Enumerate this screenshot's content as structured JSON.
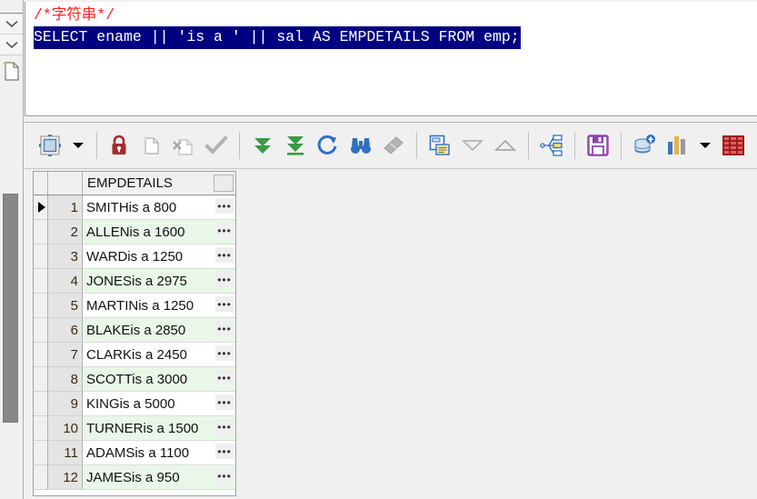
{
  "editor": {
    "comment": "/*字符串*/",
    "sql": "SELECT ename || 'is a ' || sal AS EMPDETAILS FROM emp;"
  },
  "toolbar": {
    "items": [
      {
        "name": "fit-grid-icon",
        "label": "Fit grid columns"
      },
      {
        "name": "fit-grid-dropdown-icon",
        "label": "Fit options"
      },
      {
        "name": "lock-icon",
        "label": "Lock record"
      },
      {
        "name": "new-record-icon",
        "label": "Insert record"
      },
      {
        "name": "delete-record-icon",
        "label": "Delete record"
      },
      {
        "name": "commit-check-icon",
        "label": "Post changes"
      },
      {
        "name": "fetch-next-icon",
        "label": "Fetch next page"
      },
      {
        "name": "fetch-all-icon",
        "label": "Fetch all rows"
      },
      {
        "name": "refresh-icon",
        "label": "Refresh"
      },
      {
        "name": "find-binoculars-icon",
        "label": "Find"
      },
      {
        "name": "eraser-icon",
        "label": "Clear filter"
      },
      {
        "name": "single-record-view-icon",
        "label": "Single record view"
      },
      {
        "name": "move-down-icon",
        "label": "Move down"
      },
      {
        "name": "move-up-icon",
        "label": "Move up"
      },
      {
        "name": "hierarchy-icon",
        "label": "Structure view"
      },
      {
        "name": "save-floppy-icon",
        "label": "Export data"
      },
      {
        "name": "database-upload-icon",
        "label": "Send to database"
      },
      {
        "name": "bar-chart-icon",
        "label": "Chart"
      },
      {
        "name": "bar-chart-dropdown-icon",
        "label": "Chart options"
      },
      {
        "name": "red-grid-icon",
        "label": "Grid view"
      }
    ]
  },
  "left_rail": {
    "buttons": [
      {
        "name": "rail-top-button",
        "label": ""
      },
      {
        "name": "rail-collapse-button-1",
        "label": "chevron-down"
      },
      {
        "name": "rail-collapse-button-2",
        "label": "chevron-down"
      },
      {
        "name": "rail-new-document-button",
        "label": "new-document"
      }
    ]
  },
  "grid": {
    "columns": [
      "EMPDETAILS"
    ],
    "cell_button_label": "•••",
    "rows": [
      {
        "num": "1",
        "EMPDETAILS": "SMITHis a 800",
        "current": true
      },
      {
        "num": "2",
        "EMPDETAILS": "ALLENis a 1600",
        "current": false
      },
      {
        "num": "3",
        "EMPDETAILS": "WARDis a 1250",
        "current": false
      },
      {
        "num": "4",
        "EMPDETAILS": "JONESis a 2975",
        "current": false
      },
      {
        "num": "5",
        "EMPDETAILS": "MARTINis a 1250",
        "current": false
      },
      {
        "num": "6",
        "EMPDETAILS": "BLAKEis a 2850",
        "current": false
      },
      {
        "num": "7",
        "EMPDETAILS": "CLARKis a 2450",
        "current": false
      },
      {
        "num": "8",
        "EMPDETAILS": "SCOTTis a 3000",
        "current": false
      },
      {
        "num": "9",
        "EMPDETAILS": "KINGis a 5000",
        "current": false
      },
      {
        "num": "10",
        "EMPDETAILS": "TURNERis a 1500",
        "current": false
      },
      {
        "num": "11",
        "EMPDETAILS": "ADAMSis a 1100",
        "current": false
      },
      {
        "num": "12",
        "EMPDETAILS": "JAMESis a 950",
        "current": false
      }
    ]
  },
  "colors": {
    "selection_blue": "#000080",
    "comment_red": "#ff2020",
    "alt_row_green": "#e9f7e9",
    "lock_red": "#a62b2b",
    "arrow_green": "#3a9a46",
    "refresh_blue": "#2f6fc4",
    "save_purple": "#8e44ad",
    "grid_icon_red": "#a01c1c"
  }
}
